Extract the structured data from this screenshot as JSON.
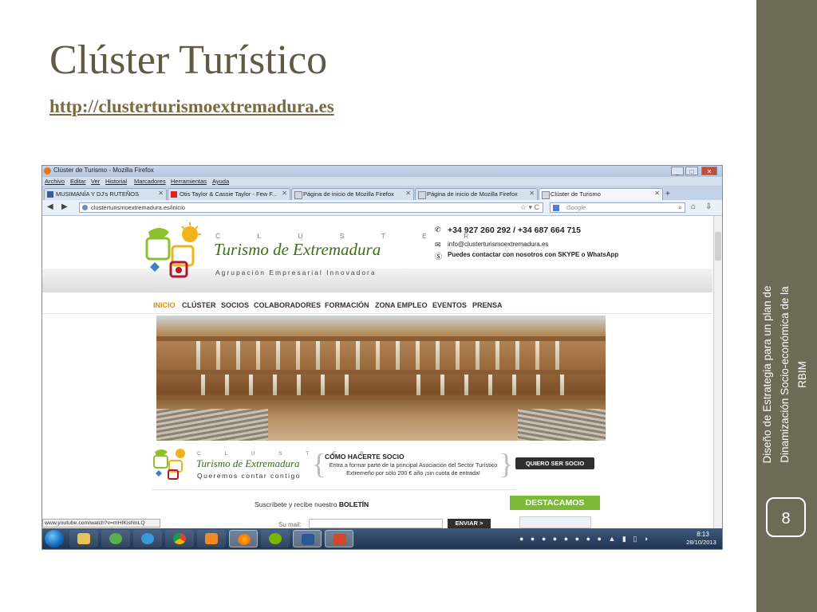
{
  "slide": {
    "title": "Clúster Turístico",
    "link": "http://clusterturismoextremadura.es",
    "side_text": "Diseño de Estrategia  para un plan de Dinamización Socio-económica de la RBIM",
    "page_number": "8"
  },
  "browser": {
    "window_title": "Clúster de Turismo - Mozilla Firefox",
    "menu": [
      "Archivo",
      "Editar",
      "Ver",
      "Historial",
      "Marcadores",
      "Herramientas",
      "Ayuda"
    ],
    "tabs": [
      {
        "label": "MUSIMANÍA Y DJ's RUTEÑOS",
        "active": false
      },
      {
        "label": "Otis Taylor & Cassie Taylor - Few F...",
        "active": false
      },
      {
        "label": "Página de inicio de Mozilla Firefox",
        "active": false
      },
      {
        "label": "Página de inicio de Mozilla Firefox",
        "active": false
      },
      {
        "label": "Clúster de Turismo",
        "active": true
      }
    ],
    "new_tab": "+",
    "url": "clusterturismoextremadura.es/inicio",
    "search_placeholder": "Google",
    "status_url": "www.youtube.com/watch?v=mHIKisNnLQ"
  },
  "site": {
    "logo_letters": "C L U S T E R",
    "logo_main": "Turismo de Extremadura",
    "logo_sub": "Agrupación Empresarial Innovadora",
    "phone": "+34 927 260 292 / +34 687 664 715",
    "email": "info@clusterturismoextremadura.es",
    "skype": "Puedes contactar con nosotros con SKYPE o WhatsApp",
    "nav": [
      "INICIO",
      "CLÚSTER",
      "SOCIOS",
      "COLABORADORES",
      "FORMACIÓN",
      "ZONA EMPLEO",
      "EVENTOS",
      "PRENSA"
    ],
    "logo2_sub": "Queremos contar contigo",
    "socio_title": "CÓMO HACERTE SOCIO",
    "socio_desc": "Entra a formar parte de la principal Asociación del Sector Turístico Extremeño por sólo 200 € año ¡sin cuota de entrada!",
    "quiero_btn": "QUIERO SER SOCIO",
    "subscribe": "Suscríbete y recibe nuestro",
    "subscribe_bold": "BOLETÍN",
    "destacamos": "DESTACAMOS",
    "mail_label": "Su mail:",
    "enviar_btn": "ENVIAR >"
  },
  "taskbar": {
    "time": "8:13",
    "date": "28/10/2013"
  },
  "colors": {
    "side_panel": "#6e6a55",
    "title": "#5f5a44",
    "accent_green": "#7cb83a",
    "nav_active": "#e08a00"
  }
}
